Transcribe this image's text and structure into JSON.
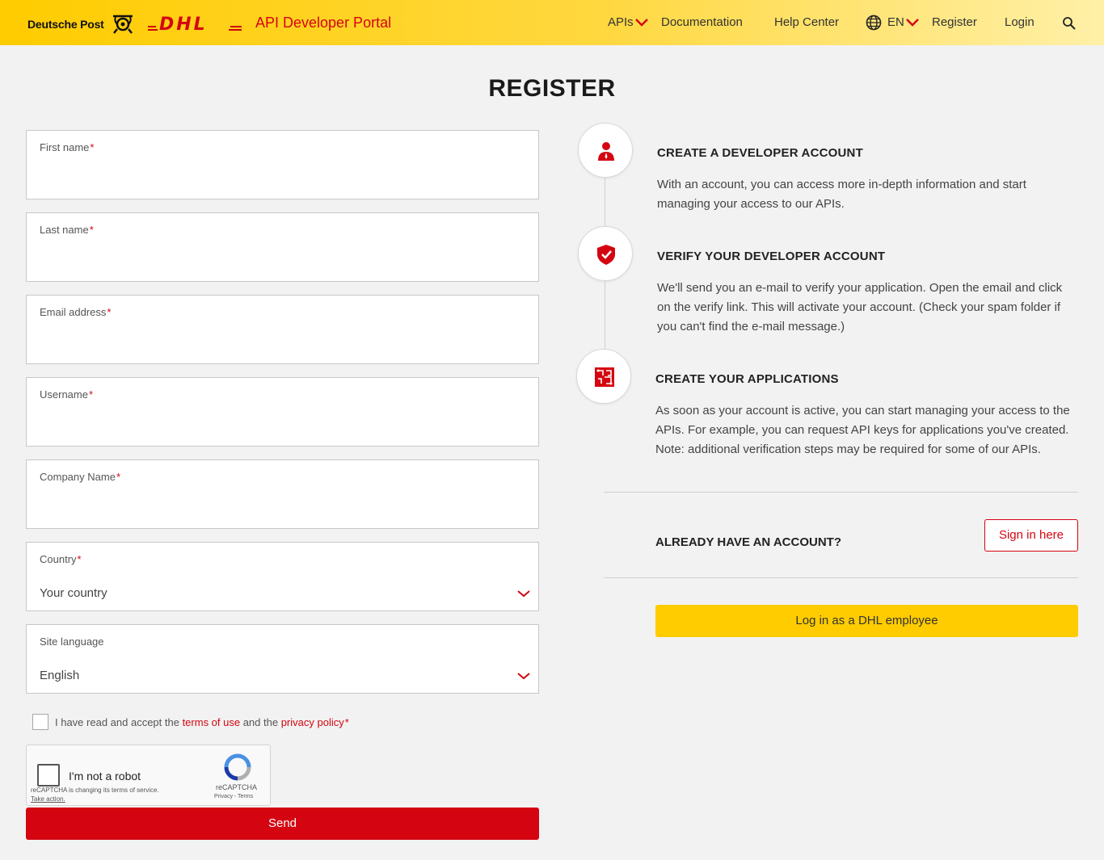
{
  "header": {
    "brand_deutsche_post": "Deutsche Post",
    "brand_dhl": "DHL",
    "portal_title": "API Developer Portal",
    "nav": {
      "apis": "APIs",
      "documentation": "Documentation",
      "help_center": "Help Center",
      "language": "EN",
      "register": "Register",
      "login": "Login"
    },
    "icons": [
      "posthorn-logo",
      "dhl-logo",
      "chevron-down-icon",
      "globe-icon",
      "search-icon"
    ]
  },
  "page": {
    "title": "REGISTER"
  },
  "form": {
    "required_mark": "*",
    "fields": [
      {
        "label": "First name",
        "required": true,
        "value": ""
      },
      {
        "label": "Last name",
        "required": true,
        "value": ""
      },
      {
        "label": "Email address",
        "required": true,
        "value": ""
      },
      {
        "label": "Username",
        "required": true,
        "value": ""
      },
      {
        "label": "Company Name",
        "required": true,
        "value": ""
      },
      {
        "label": "Country",
        "required": true,
        "value": "Your country"
      },
      {
        "label": "Site language",
        "required": false,
        "value": "English"
      }
    ],
    "terms": {
      "prefix": "I have read and accept the ",
      "terms_link": "terms of use",
      "middle": " and the ",
      "privacy_link": "privacy policy",
      "checked": false
    },
    "captcha": {
      "label": "I'm not a robot",
      "notice": "reCAPTCHA is changing its terms of service.",
      "action": "Take action.",
      "brand": "reCAPTCHA",
      "privacy": "Privacy - Terms"
    },
    "submit_label": "Send"
  },
  "steps": [
    {
      "title": "CREATE A DEVELOPER ACCOUNT",
      "text": "With an account, you can access more in-depth information and start managing your access to our APIs.",
      "icon": "user-icon"
    },
    {
      "title": "VERIFY YOUR DEVELOPER ACCOUNT",
      "text": "We'll send you an e-mail to verify your application. Open the email and click on the verify link. This will activate your account. (Check your spam folder if you can't find the e-mail message.)",
      "icon": "shield-check-icon"
    },
    {
      "title": "CREATE YOUR APPLICATIONS",
      "text": "As soon as your account is active, you can start managing your access to the APIs. For example, you can request API keys for applications you've created. Note: additional verification steps may be required for some of our APIs.",
      "icon": "circuit-icon"
    }
  ],
  "account": {
    "already_label": "ALREADY HAVE AN ACCOUNT?",
    "sign_in_label": "Sign in here",
    "employee_label": "Log in as a DHL employee"
  },
  "colors": {
    "brand_yellow": "#ffcc00",
    "brand_red": "#d40511",
    "background": "#f2f2f2"
  }
}
